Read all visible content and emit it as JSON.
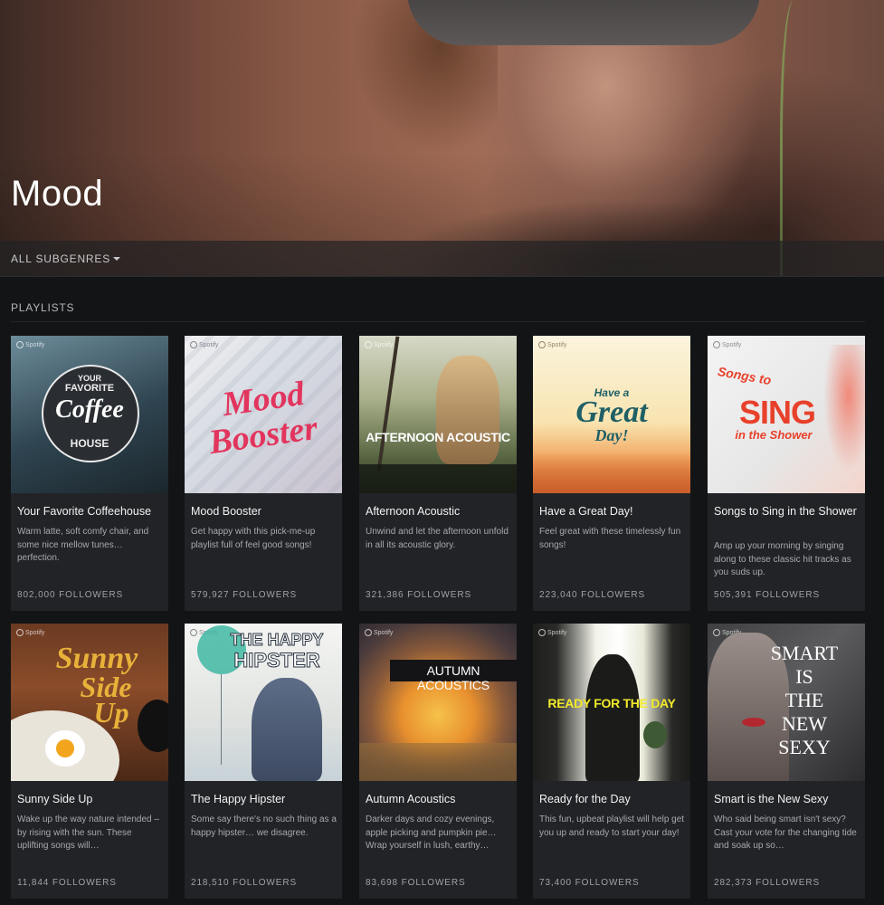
{
  "hero": {
    "title": "Mood"
  },
  "subgenres": {
    "label": "ALL SUBGENRES"
  },
  "section": {
    "title": "PLAYLISTS"
  },
  "spotify_tag": "Spotify",
  "colors": {
    "background": "#131416",
    "card": "#222326",
    "text_muted": "#a7a9ad"
  },
  "playlists": [
    {
      "name": "Your Favorite Coffeehouse",
      "description": "Warm latte, soft comfy chair, and some nice mellow tunes… perfection.",
      "followers": "802,000 FOLLOWERS",
      "art": {
        "line1": "YOUR",
        "line2": "FAVORITE",
        "line3": "Coffee",
        "line4": "HOUSE"
      }
    },
    {
      "name": "Mood Booster",
      "description": "Get happy with this pick-me-up playlist full of feel good songs!",
      "followers": "579,927 FOLLOWERS",
      "art": {
        "line1": "Mood",
        "line2": "Booster"
      }
    },
    {
      "name": "Afternoon Acoustic",
      "description": "Unwind and let the afternoon unfold in all its acoustic glory.",
      "followers": "321,386 FOLLOWERS",
      "art": {
        "line1": "AFTERNOON ACOUSTIC"
      }
    },
    {
      "name": "Have a Great Day!",
      "description": "Feel great with these timelessly fun songs!",
      "followers": "223,040 FOLLOWERS",
      "art": {
        "line1": "Have a",
        "line2": "Great",
        "line3": "Day!"
      }
    },
    {
      "name": "Songs to Sing in the Shower",
      "description": "Amp up your morning by singing along to these classic hit tracks as you suds up.",
      "followers": "505,391 FOLLOWERS",
      "art": {
        "line1": "Songs to",
        "line2": "SING",
        "line3": "in the Shower"
      }
    },
    {
      "name": "Sunny Side Up",
      "description": "Wake up the way nature intended – by rising with the sun. These uplifting songs will…",
      "followers": "11,844 FOLLOWERS",
      "art": {
        "line1": "Sunny",
        "line2": "Side",
        "line3": "Up"
      }
    },
    {
      "name": "The Happy Hipster",
      "description": "Some say there's no such thing as a happy hipster… we disagree.",
      "followers": "218,510 FOLLOWERS",
      "art": {
        "line1": "THE HAPPY",
        "line2": "HIPSTER"
      }
    },
    {
      "name": "Autumn Acoustics",
      "description": "Darker days and cozy evenings, apple picking and pumpkin pie… Wrap yourself in lush, earthy…",
      "followers": "83,698 FOLLOWERS",
      "art": {
        "line1": "AUTUMN ACOUSTICS"
      }
    },
    {
      "name": "Ready for the Day",
      "description": "This fun, upbeat playlist will help get you up and ready to start your day!",
      "followers": "73,400 FOLLOWERS",
      "art": {
        "line1": "READY FOR THE DAY"
      }
    },
    {
      "name": "Smart is the New Sexy",
      "description": "Who said being smart isn't sexy? Cast your vote for the changing tide and soak up so…",
      "followers": "282,373 FOLLOWERS",
      "art": {
        "line1": "SMART",
        "line2": "IS",
        "line3": "THE",
        "line4": "NEW",
        "line5": "SEXY"
      }
    }
  ]
}
